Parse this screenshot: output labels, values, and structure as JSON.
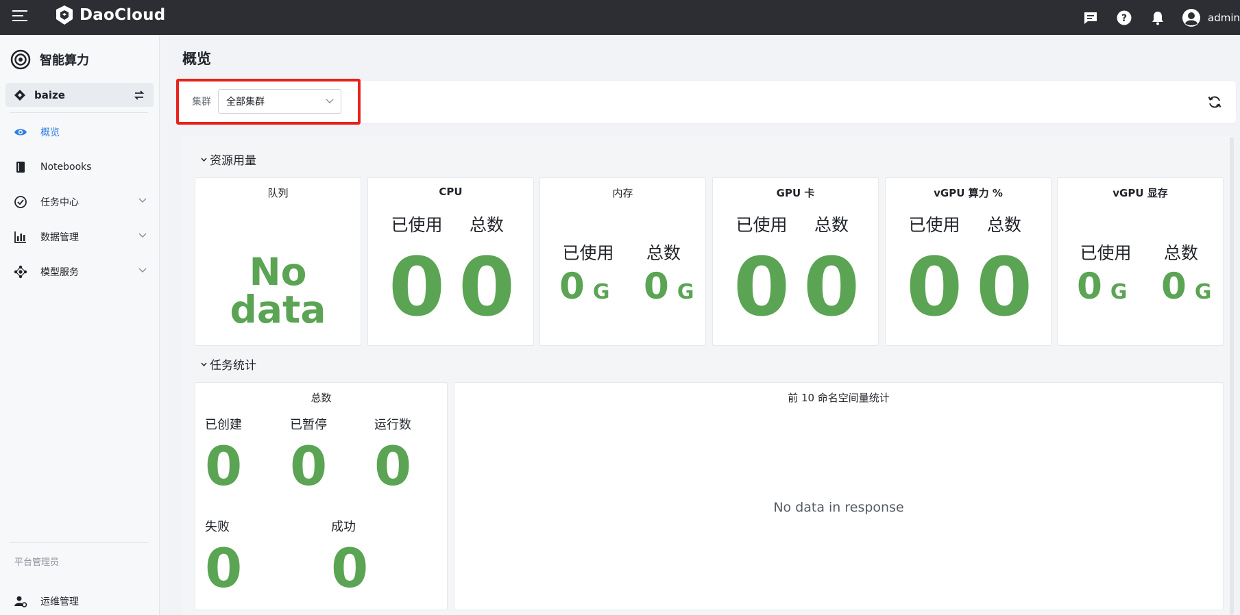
{
  "topbar": {
    "brand": "DaoCloud",
    "username": "admin",
    "icons": [
      "hamburger-icon",
      "message-icon",
      "help-icon",
      "bell-icon",
      "user-avatar-icon"
    ]
  },
  "sidebar": {
    "app_title": "智能算力",
    "workspace": "baize",
    "items": [
      {
        "label": "概览",
        "icon": "eye-icon",
        "active": true
      },
      {
        "label": "Notebooks",
        "icon": "notebook-icon"
      },
      {
        "label": "任务中心",
        "icon": "task-check-icon",
        "expandable": true
      },
      {
        "label": "数据管理",
        "icon": "data-chart-icon",
        "expandable": true
      },
      {
        "label": "模型服务",
        "icon": "model-service-icon",
        "expandable": true
      }
    ],
    "footer_label": "平台管理员",
    "ops_label": "运维管理"
  },
  "page": {
    "title": "概览"
  },
  "filter": {
    "label": "集群",
    "cluster_value": "全部集群"
  },
  "resource": {
    "section_title": "资源用量",
    "queue": {
      "title": "队列",
      "value": "No data"
    },
    "cpu": {
      "title": "CPU",
      "used_label": "已使用",
      "total_label": "总数",
      "used": "0",
      "total": "0"
    },
    "memory": {
      "title": "内存",
      "used_label": "已使用",
      "total_label": "总数",
      "used": "0",
      "total": "0",
      "unit": "G"
    },
    "gpu": {
      "title": "GPU 卡",
      "used_label": "已使用",
      "total_label": "总数",
      "used": "0",
      "total": "0"
    },
    "vgpu_compute": {
      "title": "vGPU 算力 %",
      "used_label": "已使用",
      "total_label": "总数",
      "used": "0",
      "total": "0"
    },
    "vgpu_memory": {
      "title": "vGPU 显存",
      "used_label": "已使用",
      "total_label": "总数",
      "used": "0",
      "total": "0",
      "unit": "G"
    }
  },
  "tasks": {
    "section_title": "任务统计",
    "summary": {
      "title": "总数",
      "created_label": "已创建",
      "created": "0",
      "paused_label": "已暂停",
      "paused": "0",
      "running_label": "运行数",
      "running": "0",
      "failed_label": "失败",
      "failed": "0",
      "success_label": "成功",
      "success": "0"
    },
    "namespace": {
      "title": "前 10 命名空间量统计",
      "empty": "No data in response"
    }
  },
  "colors": {
    "topbar": "#2c2e33",
    "accent": "#2e7de1",
    "value_green": "#5aa454",
    "highlight_red": "#e8211b"
  }
}
